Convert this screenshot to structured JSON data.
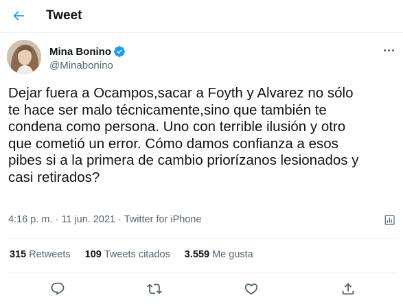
{
  "header": {
    "back_icon": "arrow-left-icon",
    "title": "Tweet"
  },
  "author": {
    "display_name": "Mina Bonino",
    "handle": "@Minabonino",
    "verified": true,
    "verified_icon": "verified-badge-icon",
    "more_icon": "more-horizontal-icon"
  },
  "tweet": {
    "text": "Dejar fuera a Ocampos,sacar a Foyth y Alvarez no sólo\nte hace ser malo técnicamente,sino que también te\ncondena como persona. Uno con terrible ilusión y otro\nque cometió un error. Cómo damos confianza a esos\npibes si a la primera de cambio priorízanos lesionados y\ncasi retirados?",
    "meta": "4:16 p. m. · 11 jun. 2021 · Twitter for iPhone",
    "analytics_icon": "analytics-icon"
  },
  "stats": [
    {
      "count": "315",
      "label": "Retweets"
    },
    {
      "count": "109",
      "label": "Tweets citados"
    },
    {
      "count": "3.559",
      "label": "Me gusta"
    }
  ],
  "actions": [
    {
      "icon": "reply-icon"
    },
    {
      "icon": "retweet-icon"
    },
    {
      "icon": "like-icon"
    },
    {
      "icon": "share-icon"
    }
  ],
  "colors": {
    "accent": "#1d9bf0",
    "text_primary": "#0f1419",
    "text_secondary": "#536471",
    "divider": "#eff3f4"
  }
}
